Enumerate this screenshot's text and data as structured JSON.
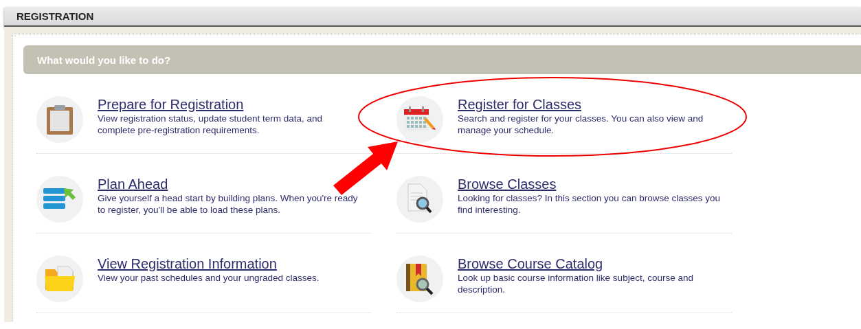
{
  "header": {
    "title": "REGISTRATION"
  },
  "banner": {
    "title": "What would you like to do?"
  },
  "options": [
    {
      "title": "Prepare for Registration",
      "description": "View registration status, update student term data, and complete pre-registration requirements.",
      "kind": "clipboard",
      "highlighted": false
    },
    {
      "title": "Register for Classes",
      "description": "Search and register for your classes. You can also view and manage your schedule.",
      "kind": "calendar",
      "highlighted": true
    },
    {
      "title": "Plan Ahead",
      "description": "Give yourself a head start by building plans. When you're ready to register, you'll be able to load these plans.",
      "kind": "list",
      "highlighted": false
    },
    {
      "title": "Browse Classes",
      "description": "Looking for classes? In this section you can browse classes you find interesting.",
      "kind": "document-search",
      "highlighted": false
    },
    {
      "title": "View Registration Information",
      "description": "View your past schedules and your ungraded classes.",
      "kind": "folder",
      "highlighted": false
    },
    {
      "title": "Browse Course Catalog",
      "description": "Look up basic course information like subject, course and description.",
      "kind": "book-search",
      "highlighted": false
    }
  ]
}
